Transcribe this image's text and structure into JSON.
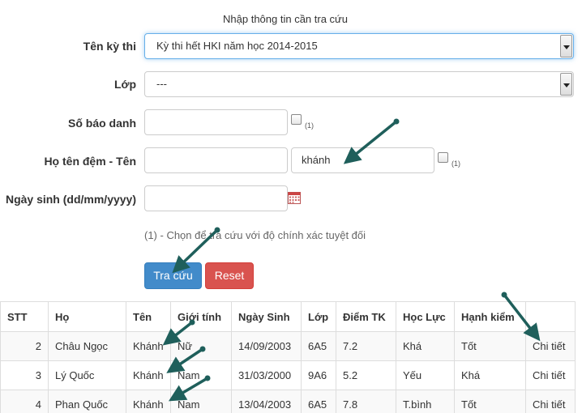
{
  "form": {
    "heading": "Nhập thông tin cần tra cứu",
    "exam_label": "Tên kỳ thi",
    "exam_value": "Kỳ thi hết HKI năm học 2014-2015",
    "class_label": "Lớp",
    "class_value": "---",
    "sbd_label": "Số báo danh",
    "sbd_value": "",
    "sbd_note": "(1)",
    "name_label": "Họ tên đệm - Tên",
    "middle_value": "",
    "first_value": "khánh",
    "name_note": "(1)",
    "dob_label": "Ngày sinh (dd/mm/yyyy)",
    "dob_value": "",
    "hint": "(1) - Chọn để tra cứu với độ chính xác tuyệt đối",
    "search_label": "Tra cứu",
    "reset_label": "Reset"
  },
  "table": {
    "headers": [
      "STT",
      "Họ",
      "Tên",
      "Giới tính",
      "Ngày Sinh",
      "Lớp",
      "Điểm TK",
      "Học Lực",
      "Hạnh kiểm",
      ""
    ],
    "rows": [
      [
        "2",
        "Châu Ngọc",
        "Khánh",
        "Nữ",
        "14/09/2003",
        "6A5",
        "7.2",
        "Khá",
        "Tốt",
        "Chi tiết"
      ],
      [
        "3",
        "Lý Quốc",
        "Khánh",
        "Nam",
        "31/03/2000",
        "9A6",
        "5.2",
        "Yếu",
        "Khá",
        "Chi tiết"
      ],
      [
        "4",
        "Phan Quốc",
        "Khánh",
        "Nam",
        "13/04/2003",
        "6A5",
        "7.8",
        "T.bình",
        "Tốt",
        "Chi tiết"
      ]
    ]
  },
  "colors": {
    "primary": "#428bca",
    "danger": "#d9534f",
    "arrow": "#1f5f5b"
  },
  "icons": {
    "calendar": "calendar-icon",
    "dropdown": "chevron-down-icon",
    "annotation": "arrow-icon"
  }
}
